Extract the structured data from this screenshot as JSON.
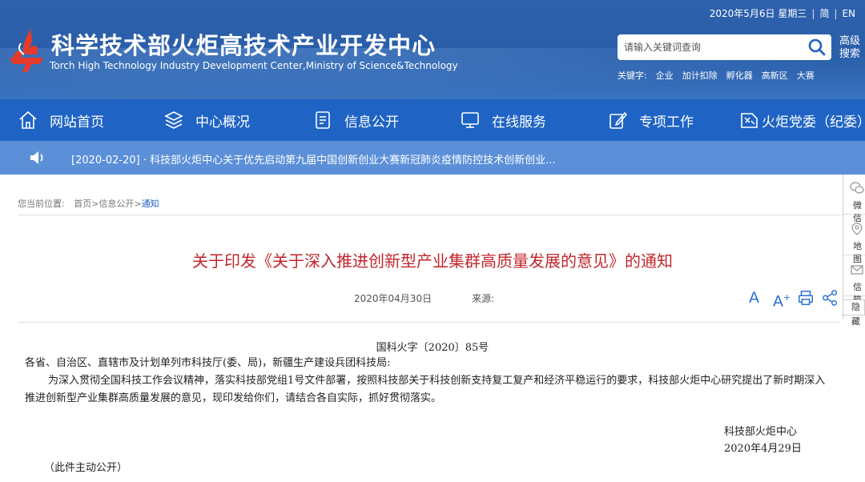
{
  "header": {
    "title": "科学技术部火炬高技术产业开发中心",
    "subtitle": "Torch High Technology Industry Development Center,Ministry of Science&Technology",
    "date": "2020年5月6日 星期三",
    "lang_simplified": "简",
    "lang_english": "EN",
    "search": {
      "placeholder": "请输入关键词查询"
    },
    "advanced_search": "高级搜索",
    "keywords_label": "关键字:",
    "keywords": [
      "企业",
      "加计扣除",
      "孵化器",
      "高新区",
      "大赛"
    ]
  },
  "nav": {
    "items": [
      {
        "label": "网站首页",
        "icon": "home-icon"
      },
      {
        "label": "中心概况",
        "icon": "layers-icon"
      },
      {
        "label": "信息公开",
        "icon": "document-icon"
      },
      {
        "label": "在线服务",
        "icon": "monitor-icon"
      },
      {
        "label": "专项工作",
        "icon": "clipboard-icon"
      },
      {
        "label": "火炬党委（纪委）",
        "icon": "party-icon"
      }
    ]
  },
  "notice": {
    "text": "[2020-02-20] · 科技部火炬中心关于优先启动第九届中国创新创业大赛新冠肺炎疫情防控技术创新创业..."
  },
  "breadcrumb": {
    "label": "您当前位置:",
    "home": "首页",
    "sep1": ">",
    "section": "信息公开",
    "sep2": ">",
    "current": "通知"
  },
  "article": {
    "title": "关于印发《关于深入推进创新型产业集群高质量发展的意见》的通知",
    "date": "2020年04月30日",
    "source_label": "来源:",
    "doc_number": "国科火字〔2020〕85号",
    "recipients": "各省、自治区、直辖市及计划单列市科技厅(委、局)，新疆生产建设兵团科技局:",
    "paragraph": "为深入贯彻全国科技工作会议精神，落实科技部党组1号文件部署，按照科技部关于科技创新支持复工复产和经济平稳运行的要求，科技部火炬中心研究提出了新时期深入推进创新型产业集群高质量发展的意见，现印发给你们，请结合各自实际，抓好贯彻落实。",
    "signer": "科技部火炬中心",
    "sign_date": "2020年4月29日",
    "public_note": "（此件主动公开）"
  },
  "tools": {
    "font_decrease": "A",
    "font_increase": "A",
    "font_increase_sup": "+"
  },
  "side_panel": {
    "items": [
      {
        "label": "微信",
        "icon": "wechat-icon"
      },
      {
        "label": "地图",
        "icon": "map-pin-icon"
      },
      {
        "label": "信箱",
        "icon": "mail-icon"
      }
    ],
    "hide_label": "隐藏"
  },
  "colors": {
    "header_bg": "#2e61ad",
    "nav_bg": "#1f64c4",
    "notice_bg": "#5b90d9",
    "title_red": "#c0262b"
  }
}
